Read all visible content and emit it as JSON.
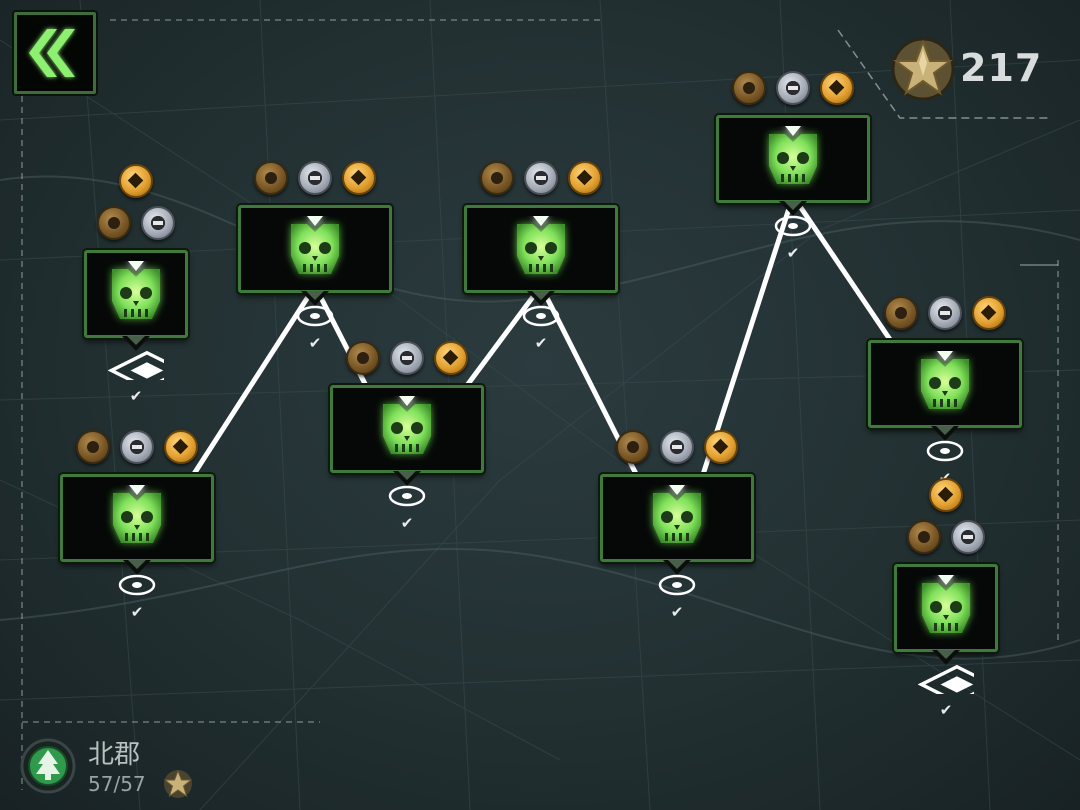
{
  "header": {
    "back_icon": "double-chevron-left-icon",
    "star_icon": "gold-star-icon",
    "star_total": "217"
  },
  "region": {
    "icon": "pine-tree-icon",
    "name": "北郡",
    "progress": "57/57",
    "progress_icon": "star-icon"
  },
  "colors": {
    "frame_green": "#3f7a3c",
    "emblem_green": "#7fe05a",
    "path_white": "#ffffff",
    "medal_bronze": "#7a5826",
    "medal_silver": "#a6adb8",
    "medal_gold": "#e2a030"
  },
  "levels": [
    {
      "id": 1,
      "medals": [
        "gold",
        "bronze",
        "silver"
      ],
      "anchor": "diamond",
      "completed": true
    },
    {
      "id": 2,
      "medals": [
        "bronze",
        "silver",
        "gold"
      ],
      "anchor": "ring",
      "completed": true
    },
    {
      "id": 3,
      "medals": [
        "bronze",
        "silver",
        "gold"
      ],
      "anchor": "ring",
      "completed": true
    },
    {
      "id": 4,
      "medals": [
        "bronze",
        "silver",
        "gold"
      ],
      "anchor": "ring",
      "completed": true
    },
    {
      "id": 5,
      "medals": [
        "bronze",
        "silver",
        "gold"
      ],
      "anchor": "ring",
      "completed": true
    },
    {
      "id": 6,
      "medals": [
        "bronze",
        "silver",
        "gold"
      ],
      "anchor": "ring",
      "completed": true
    },
    {
      "id": 7,
      "medals": [
        "bronze",
        "silver",
        "gold"
      ],
      "anchor": "ring",
      "completed": true
    },
    {
      "id": 8,
      "medals": [
        "bronze",
        "silver",
        "gold"
      ],
      "anchor": "ring",
      "completed": true
    },
    {
      "id": 9,
      "medals": [
        "gold",
        "bronze",
        "silver"
      ],
      "anchor": "diamond",
      "completed": true
    }
  ],
  "level_icon": "skull-shield-emblem-icon",
  "completed_icon": "checkmark-icon"
}
